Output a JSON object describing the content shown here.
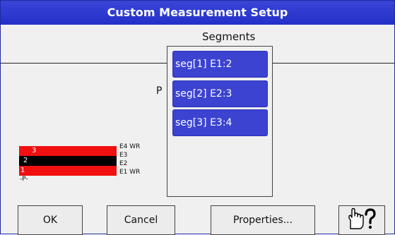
{
  "window": {
    "title": "Custom Measurement Setup"
  },
  "segments": {
    "heading": "Segments",
    "p_label": "P",
    "items": [
      {
        "label": "seg[1] E1:2"
      },
      {
        "label": "seg[2] E2:3"
      },
      {
        "label": "seg[3] E3:4"
      }
    ]
  },
  "diagram": {
    "band_numbers": [
      "3",
      "2",
      "1"
    ],
    "electrodes": [
      "E4 WR",
      "E3",
      "E2",
      "E1 WR"
    ],
    "p_marker": "-P-",
    "colors": {
      "band_red": "#f01010",
      "band_black": "#000000"
    }
  },
  "buttons": {
    "ok": "OK",
    "cancel": "Cancel",
    "properties": "Properties...",
    "help_icon": "pointing-hand-question-icon"
  },
  "colors": {
    "accent": "#3b43d0",
    "titlebar": "#2a35c8"
  }
}
